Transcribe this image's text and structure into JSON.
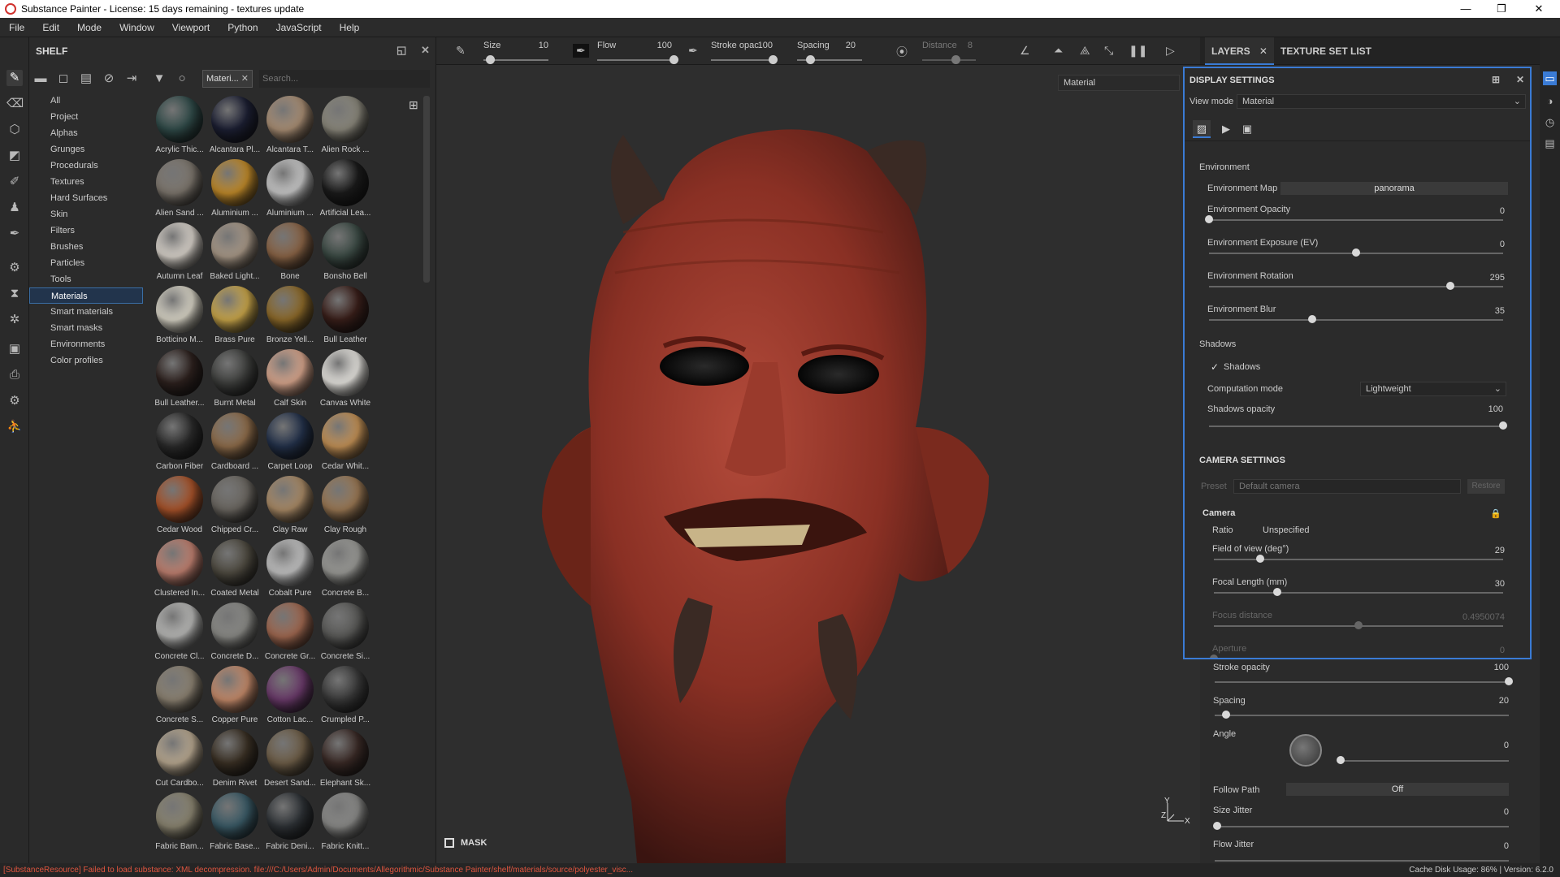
{
  "window": {
    "title": "Substance Painter - License: 15 days remaining - textures update",
    "controls": [
      "—",
      "❐",
      "✕"
    ]
  },
  "menu": [
    "File",
    "Edit",
    "Mode",
    "Window",
    "Viewport",
    "Python",
    "JavaScript",
    "Help"
  ],
  "shelf": {
    "title": "SHELF",
    "filter_chip": "Materi...",
    "search_placeholder": "Search...",
    "categories": [
      "All",
      "Project",
      "Alphas",
      "Grunges",
      "Procedurals",
      "Textures",
      "Hard Surfaces",
      "Skin",
      "Filters",
      "Brushes",
      "Particles",
      "Tools",
      "Materials",
      "Smart materials",
      "Smart masks",
      "Environments",
      "Color profiles"
    ],
    "selected_category": "Materials",
    "materials": [
      {
        "name": "Acrylic Thic...",
        "color": "#2f4a48"
      },
      {
        "name": "Alcantara Pl...",
        "color": "#1c1f33"
      },
      {
        "name": "Alcantara T...",
        "color": "#a98e74"
      },
      {
        "name": "Alien Rock ...",
        "color": "#8a877b"
      },
      {
        "name": "Alien Sand ...",
        "color": "#7d766d"
      },
      {
        "name": "Aluminium ...",
        "color": "#c08a2a"
      },
      {
        "name": "Aluminium ...",
        "color": "#c8c8c8"
      },
      {
        "name": "Artificial Lea...",
        "color": "#1b1b1b"
      },
      {
        "name": "Autumn Leaf",
        "color": "#d8d2ca"
      },
      {
        "name": "Baked Light...",
        "color": "#a89887"
      },
      {
        "name": "Bone",
        "color": "#8a6446"
      },
      {
        "name": "Bonsho Bell",
        "color": "#3b4a44"
      },
      {
        "name": "Botticino M...",
        "color": "#d8d4c6"
      },
      {
        "name": "Brass Pure",
        "color": "#c9a64a"
      },
      {
        "name": "Bronze Yell...",
        "color": "#8d6a2a"
      },
      {
        "name": "Bull Leather",
        "color": "#3a1f1a"
      },
      {
        "name": "Bull Leather...",
        "color": "#2d211e"
      },
      {
        "name": "Burnt Metal",
        "color": "#3e3f3d"
      },
      {
        "name": "Calf Skin",
        "color": "#d7a58c"
      },
      {
        "name": "Canvas White",
        "color": "#e6e4df"
      },
      {
        "name": "Carbon Fiber",
        "color": "#2a2a2a"
      },
      {
        "name": "Cardboard ...",
        "color": "#8e6c4a"
      },
      {
        "name": "Carpet Loop",
        "color": "#23314a"
      },
      {
        "name": "Cedar Whit...",
        "color": "#c39156"
      },
      {
        "name": "Cedar Wood",
        "color": "#a8532a"
      },
      {
        "name": "Chipped Cr...",
        "color": "#6a6660"
      },
      {
        "name": "Clay Raw",
        "color": "#a98a66"
      },
      {
        "name": "Clay Rough",
        "color": "#9a7854"
      },
      {
        "name": "Clustered In...",
        "color": "#c08070"
      },
      {
        "name": "Coated Metal",
        "color": "#4e4a40"
      },
      {
        "name": "Cobalt Pure",
        "color": "#c2c2c2"
      },
      {
        "name": "Concrete B...",
        "color": "#9a9a96"
      },
      {
        "name": "Concrete Cl...",
        "color": "#b8b8b6"
      },
      {
        "name": "Concrete D...",
        "color": "#8a8a86"
      },
      {
        "name": "Concrete Gr...",
        "color": "#a06850"
      },
      {
        "name": "Concrete Si...",
        "color": "#5a5a58"
      },
      {
        "name": "Concrete S...",
        "color": "#8c8272"
      },
      {
        "name": "Copper Pure",
        "color": "#c48a6a"
      },
      {
        "name": "Cotton Lac...",
        "color": "#6a3a6a"
      },
      {
        "name": "Crumpled P...",
        "color": "#3a3a3a"
      },
      {
        "name": "Cut Cardbo...",
        "color": "#b8a890"
      },
      {
        "name": "Denim Rivet",
        "color": "#3a3024"
      },
      {
        "name": "Desert Sand...",
        "color": "#6e5e48"
      },
      {
        "name": "Elephant Sk...",
        "color": "#3a2a26"
      },
      {
        "name": "Fabric Bam...",
        "color": "#8a8470"
      },
      {
        "name": "Fabric Base...",
        "color": "#3a5a66"
      },
      {
        "name": "Fabric Deni...",
        "color": "#2e3236"
      },
      {
        "name": "Fabric Knitt...",
        "color": "#8a8a88"
      }
    ]
  },
  "viewport": {
    "toolbar": {
      "size_label": "Size",
      "size_value": "10",
      "size_level": 0.1,
      "flow_label": "Flow",
      "flow_value": "100",
      "flow_level": 1.0,
      "stroke_label": "Stroke opac",
      "stroke_value": "100",
      "stroke_level": 1.0,
      "spacing_label": "Spacing",
      "spacing_value": "20",
      "spacing_level": 0.2,
      "distance_label": "Distance",
      "distance_value": "8"
    },
    "material_dropdown": "Material",
    "mask_label": "MASK",
    "axis_labels": {
      "y": "Y",
      "z": "Z",
      "x": "X"
    }
  },
  "right_panel": {
    "tabs": [
      "LAYERS",
      "TEXTURE SET LIST"
    ],
    "display_settings": {
      "title": "DISPLAY SETTINGS",
      "view_mode_label": "View mode",
      "view_mode_value": "Material",
      "environment_section": "Environment",
      "environment_map_label": "Environment Map",
      "environment_map_value": "panorama",
      "sliders_env": [
        {
          "label": "Environment Opacity",
          "value": "0",
          "level": 0.0
        },
        {
          "label": "Environment Exposure (EV)",
          "value": "0",
          "level": 0.5
        },
        {
          "label": "Environment Rotation",
          "value": "295",
          "level": 0.82
        },
        {
          "label": "Environment Blur",
          "value": "35",
          "level": 0.35
        }
      ],
      "shadows_section": "Shadows",
      "shadows_checkbox": "Shadows",
      "computation_mode_label": "Computation mode",
      "computation_mode_value": "Lightweight",
      "shadows_opacity_label": "Shadows opacity",
      "shadows_opacity_value": "100",
      "shadows_opacity_level": 1.0,
      "camera_settings_title": "CAMERA SETTINGS",
      "preset_label": "Preset",
      "preset_value": "Default camera",
      "restore_label": "Restore",
      "camera_section": "Camera",
      "ratio_label": "Ratio",
      "ratio_value": "Unspecified",
      "sliders_cam": [
        {
          "label": "Field of view (deg°)",
          "value": "29",
          "level": 0.16
        },
        {
          "label": "Focal Length (mm)",
          "value": "30",
          "level": 0.22
        },
        {
          "label": "Focus distance",
          "value": "0.4950074",
          "level": 0.5
        },
        {
          "label": "Aperture",
          "value": "0",
          "level": 0.0
        }
      ]
    },
    "brush_settings": {
      "stroke_opacity_label": "Stroke opacity",
      "stroke_opacity_value": "100",
      "stroke_opacity_level": 1.0,
      "spacing_label": "Spacing",
      "spacing_value": "20",
      "spacing_level": 0.04,
      "angle_label": "Angle",
      "angle_value": "0",
      "follow_path_label": "Follow Path",
      "follow_path_value": "Off",
      "size_jitter_label": "Size Jitter",
      "size_jitter_value": "0",
      "flow_jitter_label": "Flow Jitter",
      "flow_jitter_value": "0"
    }
  },
  "status": {
    "error": "[SubstanceResource] Failed to load substance: XML decompression. file:///C:/Users/Admin/Documents/Allegorithmic/Substance Painter/shelf/materials/source/polyester_visc...",
    "cache": "Cache Disk Usage:   86% | Version: 6.2.0"
  }
}
